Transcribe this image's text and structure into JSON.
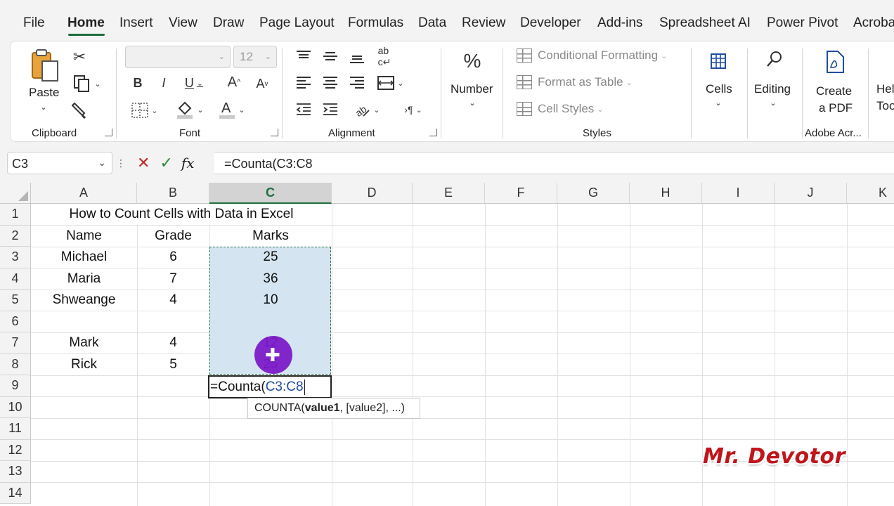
{
  "menu": {
    "tabs": [
      "File",
      "Home",
      "Insert",
      "View",
      "Draw",
      "Page Layout",
      "Formulas",
      "Data",
      "Review",
      "Developer",
      "Add-ins",
      "Spreadsheet AI",
      "Power Pivot",
      "Acroba"
    ],
    "active": "Home"
  },
  "ribbon": {
    "clipboard": {
      "label": "Clipboard",
      "paste": "Paste"
    },
    "font": {
      "label": "Font",
      "font_name": "",
      "font_size": "12"
    },
    "alignment": {
      "label": "Alignment"
    },
    "number": {
      "label": "Number"
    },
    "styles": {
      "label": "Styles",
      "conditional_formatting": "Conditional Formatting",
      "format_as_table": "Format as Table",
      "cell_styles": "Cell Styles"
    },
    "cells": {
      "label": "Cells"
    },
    "editing": {
      "label": "Editing"
    },
    "adobe": {
      "label": "Adobe Acr...",
      "create_line1": "Create",
      "create_line2": "a PDF"
    },
    "help": {
      "line1": "Hel",
      "line2": "Too"
    }
  },
  "formula_bar": {
    "name_box": "C3",
    "formula": "=Counta(C3:C8"
  },
  "grid": {
    "columns": [
      "A",
      "B",
      "C",
      "D",
      "E",
      "F",
      "G",
      "H",
      "I",
      "J",
      "K"
    ],
    "selected_column": "C",
    "rows": [
      "1",
      "2",
      "3",
      "4",
      "5",
      "6",
      "7",
      "8",
      "9",
      "10",
      "11",
      "12",
      "13",
      "14"
    ],
    "title": "How to Count Cells with Data in Excel",
    "headers": {
      "name": "Name",
      "grade": "Grade",
      "marks": "Marks"
    },
    "data": [
      {
        "name": "Michael",
        "grade": "6",
        "marks": "25"
      },
      {
        "name": "Maria",
        "grade": "7",
        "marks": "36"
      },
      {
        "name": "Shweange",
        "grade": "4",
        "marks": "10"
      },
      {
        "name": "",
        "grade": "",
        "marks": ""
      },
      {
        "name": "Mark",
        "grade": "4",
        "marks": "12"
      },
      {
        "name": "Rick",
        "grade": "5",
        "marks": "25"
      }
    ],
    "edit_cell": {
      "prefix": "=Counta(",
      "ref": "C3:C8"
    },
    "tooltip": {
      "func": "COUNTA(",
      "arg1": "value1",
      "rest": ", [value2], ...)"
    }
  },
  "watermark": "Mr. Devotor",
  "colors": {
    "accent": "#1e6e3c",
    "selection": "#d4e5f1",
    "cursor": "#7a16c8",
    "cancel": "#c0282c",
    "enter": "#2a8a3e"
  },
  "icons": [
    "cut-icon",
    "copy-icon",
    "format-painter-icon",
    "bold-icon",
    "italic-icon",
    "underline-icon",
    "grow-font-icon",
    "shrink-font-icon",
    "borders-icon",
    "fill-color-icon",
    "font-color-icon",
    "align-top-icon",
    "align-middle-icon",
    "align-bottom-icon",
    "wrap-text-icon",
    "align-left-icon",
    "align-center-icon",
    "align-right-icon",
    "merge-icon",
    "decrease-indent-icon",
    "increase-indent-icon",
    "orientation-icon",
    "rtl-icon",
    "percent-icon",
    "table-icon",
    "search-icon",
    "pdf-icon",
    "cancel-icon",
    "enter-icon",
    "fx-icon",
    "plus-cursor-icon"
  ]
}
